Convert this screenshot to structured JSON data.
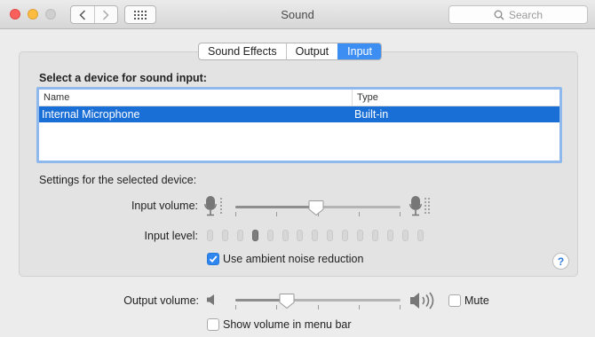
{
  "window": {
    "title": "Sound",
    "search_placeholder": "Search",
    "search_icon": "search-icon",
    "back_icon": "chevron-left-icon",
    "forward_icon": "chevron-right-icon",
    "show_all_icon": "grid-icon"
  },
  "tabs": [
    {
      "label": "Sound Effects",
      "active": false
    },
    {
      "label": "Output",
      "active": false
    },
    {
      "label": "Input",
      "active": true
    }
  ],
  "input": {
    "heading": "Select a device for sound input:",
    "columns": [
      "Name",
      "Type"
    ],
    "devices": [
      {
        "name": "Internal Microphone",
        "type": "Built-in",
        "selected": true
      }
    ],
    "settings_label": "Settings for the selected device:",
    "input_volume_label": "Input volume:",
    "input_volume_fraction": 0.49,
    "input_level_label": "Input level:",
    "input_level_bars": 15,
    "input_level_lit": 3,
    "ambient_noise_label": "Use ambient noise reduction",
    "ambient_noise_checked": true,
    "help_label": "?"
  },
  "output": {
    "volume_label": "Output volume:",
    "volume_fraction": 0.31,
    "mute_label": "Mute",
    "mute_checked": false,
    "menu_bar_label": "Show volume in menu bar",
    "menu_bar_checked": false
  },
  "colors": {
    "accent": "#3d8ef2",
    "selection": "#1a6fd6",
    "close": "#fc605c",
    "minimize": "#fdbc40"
  }
}
